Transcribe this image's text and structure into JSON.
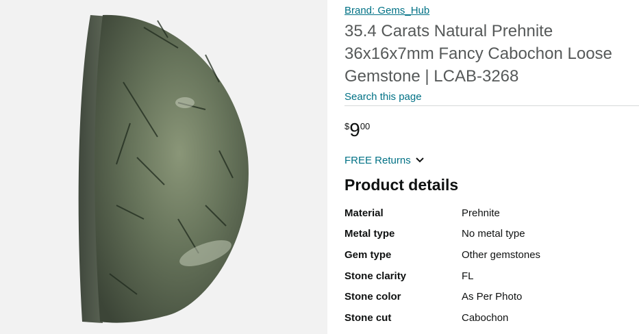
{
  "brand_link": "Brand: Gems_Hub",
  "product_title": "35.4 Carats Natural Prehnite 36x16x7mm Fancy Cabochon Loose Gemstone | LCAB-3268",
  "search_link": "Search this page",
  "price": {
    "symbol": "$",
    "whole": "9",
    "fraction": "00"
  },
  "returns_label": "FREE Returns",
  "details_heading": "Product details",
  "details": [
    {
      "label": "Material",
      "value": "Prehnite"
    },
    {
      "label": "Metal type",
      "value": "No metal type"
    },
    {
      "label": "Gem type",
      "value": "Other gemstones"
    },
    {
      "label": "Stone clarity",
      "value": "FL"
    },
    {
      "label": "Stone color",
      "value": "As Per Photo"
    },
    {
      "label": "Stone cut",
      "value": "Cabochon"
    }
  ],
  "icons": {
    "returns_chevron": "chevron-down-icon"
  },
  "colors": {
    "link": "#007185",
    "title": "#565959",
    "text": "#0f1111",
    "divider": "#d5d9d9",
    "stone_base": "#5c6a52"
  }
}
